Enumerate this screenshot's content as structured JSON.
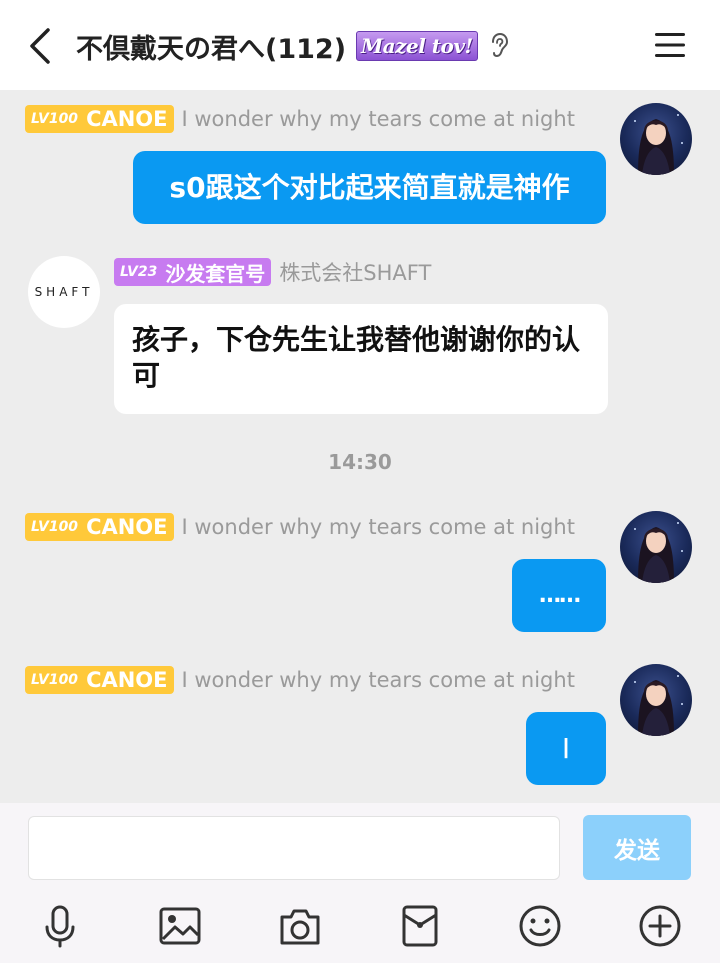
{
  "header": {
    "title": "不倶戴天の君へ(112)",
    "badge": "Mazel tov!",
    "icons": [
      "back-arrow-icon",
      "ear-icon",
      "menu-icon"
    ]
  },
  "messages": [
    {
      "side": "right",
      "level": "LV100",
      "title": "CANOE",
      "nickname": "I wonder why my tears come at night",
      "text": "s0跟这个对比起来简直就是神作"
    },
    {
      "side": "left",
      "level": "LV23",
      "title": "沙发套官号",
      "nickname": "株式会社SHAFT",
      "avatar_text": "SHAFT",
      "text": "孩子，下仓先生让我替他谢谢你的认可"
    },
    {
      "type": "time",
      "text": "14:30"
    },
    {
      "side": "right",
      "level": "LV100",
      "title": "CANOE",
      "nickname": "I wonder why my tears come at night",
      "text": "……"
    },
    {
      "side": "right",
      "level": "LV100",
      "title": "CANOE",
      "nickname": "I wonder why my tears come at night",
      "text": "I"
    }
  ],
  "input": {
    "value": "",
    "placeholder": "",
    "send_label": "发送"
  },
  "toolbar": {
    "icons": [
      "microphone-icon",
      "image-icon",
      "camera-icon",
      "red-packet-icon",
      "emoji-icon",
      "plus-icon"
    ]
  },
  "colors": {
    "accent_blue": "#0a99f2",
    "send_disabled": "#8cd0fb",
    "level_yellow": "#ffc93a",
    "level_purple": "#c77bf0",
    "background": "#ededed"
  }
}
